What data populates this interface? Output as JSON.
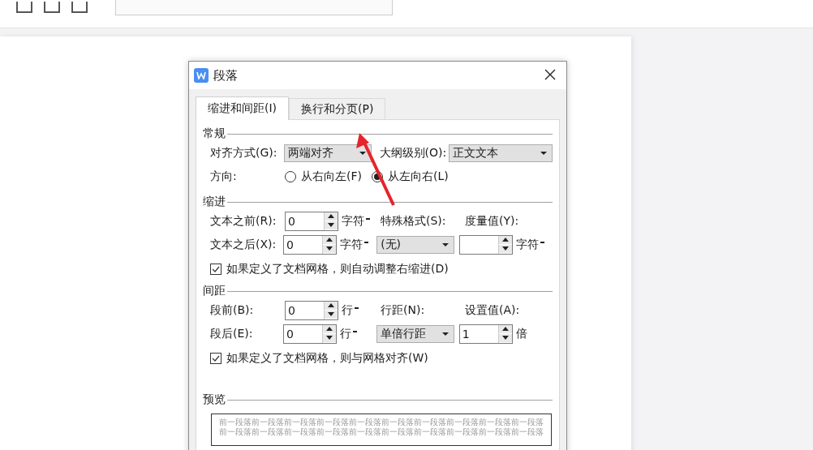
{
  "window": {
    "title": "段落"
  },
  "tabs": [
    {
      "label": "缩进和间距(I)",
      "selected": true
    },
    {
      "label": "换行和分页(P)",
      "selected": false
    }
  ],
  "general": {
    "heading": "常规",
    "alignment": {
      "label": "对齐方式(G):",
      "value": "两端对齐"
    },
    "outline_level": {
      "label": "大纲级别(O):",
      "value": "正文文本"
    },
    "direction": {
      "label": "方向:",
      "options": [
        {
          "label": "从右向左(F)",
          "selected": false
        },
        {
          "label": "从左向右(L)",
          "selected": true
        }
      ]
    }
  },
  "indent": {
    "heading": "缩进",
    "before": {
      "label": "文本之前(R):",
      "value": "0",
      "unit": "字符"
    },
    "after": {
      "label": "文本之后(X):",
      "value": "0",
      "unit": "字符"
    },
    "special": {
      "label": "特殊格式(S):",
      "value": "(无)"
    },
    "measure": {
      "label": "度量值(Y):",
      "unit": "字符"
    },
    "grid_option": {
      "label": "如果定义了文档网格，则自动调整右缩进(D)",
      "checked": true
    }
  },
  "spacing": {
    "heading": "间距",
    "before": {
      "label": "段前(B):",
      "value": "0",
      "unit": "行"
    },
    "after": {
      "label": "段后(E):",
      "value": "0",
      "unit": "行"
    },
    "line_spacing": {
      "label": "行距(N):",
      "value": "单倍行距"
    },
    "set_value": {
      "label": "设置值(A):",
      "value": "1",
      "unit": "倍",
      "unit_menu": false
    },
    "grid_option": {
      "label": "如果定义了文档网格，则与网格对齐(W)",
      "checked": true
    }
  },
  "preview": {
    "heading": "预览",
    "lines": [
      "前一段落前一段落前一段落前一段落前一段落前一段落前一段落前一段落前一段落前一段落",
      "前一段落前一段落前一段落前一段落前一段落前一段落前一段落前一段落前一段落前一段落"
    ]
  }
}
